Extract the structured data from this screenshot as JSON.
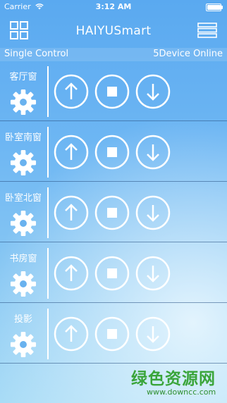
{
  "status_bar": {
    "carrier": "Carrier",
    "time": "3:12 AM",
    "battery_level": 0.95
  },
  "header": {
    "title": "HAIYUSmart",
    "left_icon": "grid-icon",
    "right_icon": "menu-icon"
  },
  "subheader": {
    "left": "Single Control",
    "right": "5Device Online"
  },
  "devices": [
    {
      "name": "客厅窗"
    },
    {
      "name": "卧室南窗"
    },
    {
      "name": "卧室北窗"
    },
    {
      "name": "书房窗"
    },
    {
      "name": "投影"
    }
  ],
  "controls": {
    "up_icon": "arrow-up-icon",
    "stop_icon": "stop-icon",
    "down_icon": "arrow-down-icon",
    "settings_icon": "gear-icon"
  },
  "watermark": {
    "text": "绿色资源网",
    "url": "www.downcc.com"
  },
  "colors": {
    "background_top": "#5aa9f0",
    "background_bottom": "#a9dcf6",
    "foreground": "#ffffff",
    "watermark": "#3aa53a"
  }
}
